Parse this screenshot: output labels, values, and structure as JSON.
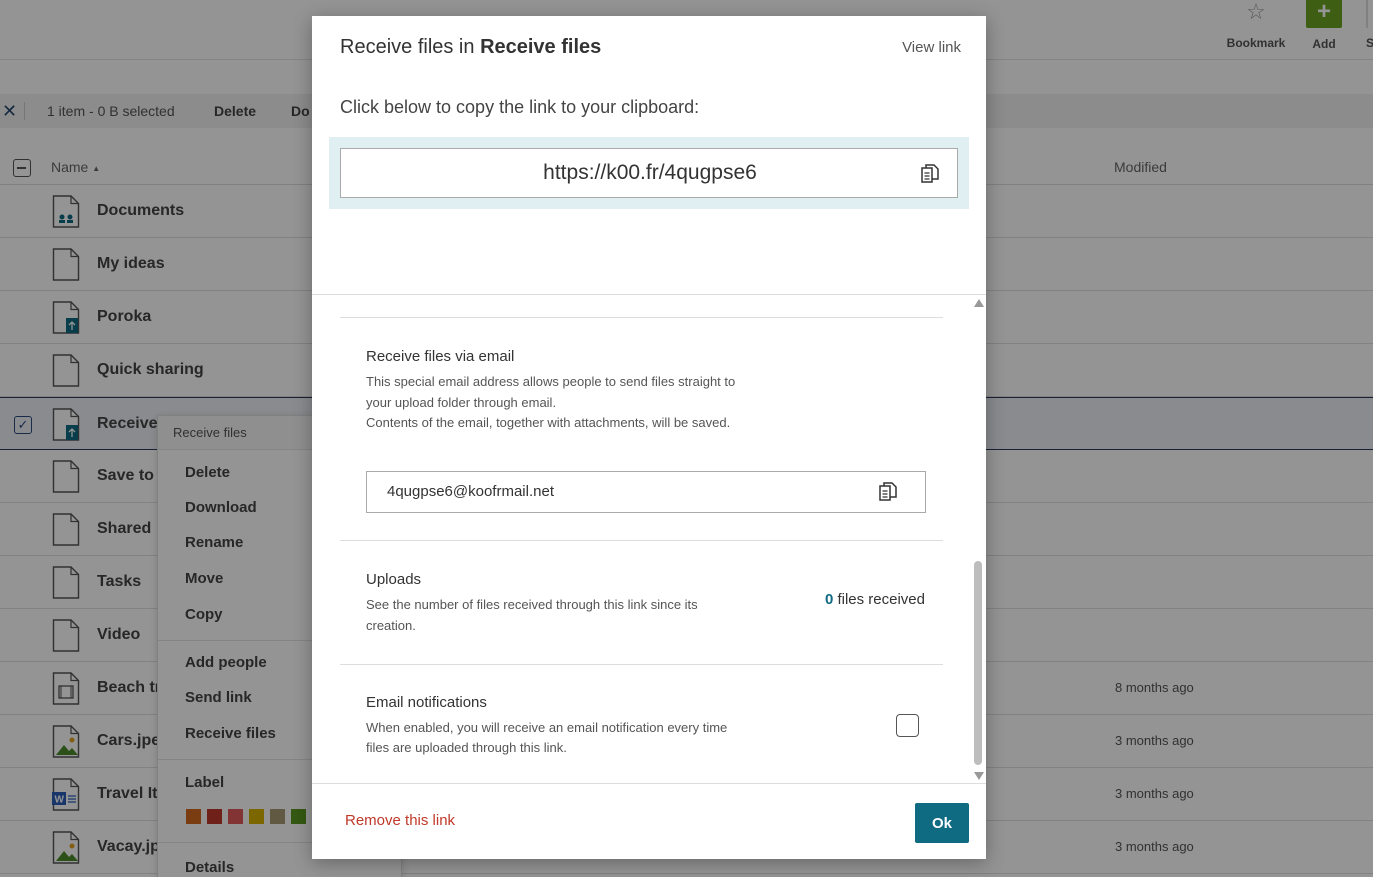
{
  "toolbar": {
    "bookmark_label": "Bookmark",
    "add_label": "Add",
    "more_label": "S"
  },
  "selection_bar": {
    "close_icon": "close-icon",
    "count_text": "1 item - 0 B selected",
    "delete_label": "Delete",
    "download_label": "Do"
  },
  "list_header": {
    "name_label": "Name",
    "sort_indicator": "▲",
    "modified_label": "Modified"
  },
  "files": [
    {
      "name": "Documents",
      "modified": ""
    },
    {
      "name": "My ideas",
      "modified": ""
    },
    {
      "name": "Poroka",
      "modified": ""
    },
    {
      "name": "Quick sharing",
      "modified": ""
    },
    {
      "name": "Receive",
      "modified": ""
    },
    {
      "name": "Save to",
      "modified": ""
    },
    {
      "name": "Shared",
      "modified": ""
    },
    {
      "name": "Tasks",
      "modified": ""
    },
    {
      "name": "Video",
      "modified": ""
    },
    {
      "name": "Beach tr",
      "modified": "8 months ago"
    },
    {
      "name": "Cars.jpeg",
      "modified": "3 months ago"
    },
    {
      "name": "Travel Iti",
      "modified": "3 months ago"
    },
    {
      "name": "Vacay.jp",
      "modified": "3 months ago"
    }
  ],
  "context_menu": {
    "header": "Receive files",
    "items": [
      "Delete",
      "Download",
      "Rename",
      "Move",
      "Copy",
      "Add people",
      "Send link",
      "Receive files",
      "Label",
      "Details"
    ],
    "label_colors": [
      "#d2691e",
      "#c0392b",
      "#e05a5a",
      "#d4b000",
      "#a89a70",
      "#5a9a20",
      "#2e7d32"
    ]
  },
  "modal": {
    "title_prefix": "Receive files in ",
    "title_folder": "Receive files",
    "view_link": "View link",
    "instruction": "Click below to copy the link to your clipboard:",
    "link_url": "https://k00.fr/4qugpse6",
    "email_section": {
      "title": "Receive files via email",
      "desc_line1": "This special email address allows people to send files straight to your upload folder through email.",
      "desc_line2": "Contents of the email, together with attachments, will be saved.",
      "address": "4qugpse6@koofrmail.net"
    },
    "uploads_section": {
      "title": "Uploads",
      "desc": "See the number of files received through this link since its creation.",
      "count": "0",
      "count_suffix": " files received"
    },
    "notifications_section": {
      "title": "Email notifications",
      "desc": "When enabled, you will receive an email notification every time files are uploaded through this link.",
      "enabled": false
    },
    "remove_link": "Remove this link",
    "ok_label": "Ok"
  }
}
